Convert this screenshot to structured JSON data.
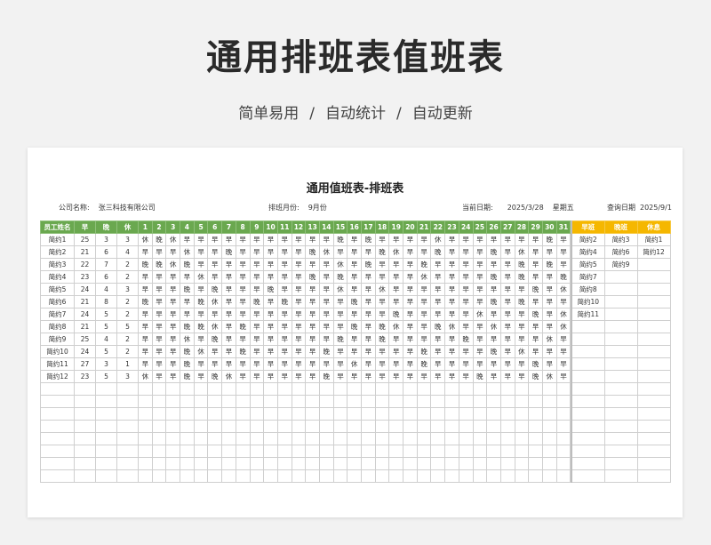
{
  "hero": {
    "title": "通用排班表值班表",
    "subtitle": [
      "简单易用",
      "自动统计",
      "自动更新"
    ],
    "separator": "/"
  },
  "sheet": {
    "title": "通用值班表-排班表",
    "company_label": "公司名称:",
    "company_value": "张三科技有限公司",
    "month_label": "排班月份:",
    "month_value": "9月份",
    "date_label": "当前日期:",
    "date_value": "2025/3/28",
    "weekday_value": "星期五",
    "query_label": "查询日期",
    "query_value": "2025/9/1"
  },
  "colors": {
    "header_green": "#6aa84f",
    "header_orange": "#f5b700"
  },
  "table": {
    "headers": [
      "员工姓名",
      "早",
      "晚",
      "休",
      "1",
      "2",
      "3",
      "4",
      "5",
      "6",
      "7",
      "8",
      "9",
      "10",
      "11",
      "12",
      "13",
      "14",
      "15",
      "16",
      "17",
      "18",
      "19",
      "20",
      "21",
      "22",
      "23",
      "24",
      "25",
      "26",
      "27",
      "28",
      "29",
      "30",
      "31"
    ],
    "rows": [
      {
        "name": "简约1",
        "early": "25",
        "late": "3",
        "off": "3",
        "days": [
          "休",
          "晚",
          "休",
          "早",
          "早",
          "早",
          "早",
          "早",
          "早",
          "早",
          "早",
          "早",
          "早",
          "早",
          "晚",
          "早",
          "晚",
          "早",
          "早",
          "早",
          "早",
          "休",
          "早",
          "早",
          "早",
          "早",
          "早",
          "早",
          "早",
          "晚",
          "早"
        ]
      },
      {
        "name": "简约2",
        "early": "21",
        "late": "6",
        "off": "4",
        "days": [
          "早",
          "早",
          "早",
          "休",
          "早",
          "早",
          "晚",
          "早",
          "早",
          "早",
          "早",
          "早",
          "晚",
          "休",
          "早",
          "早",
          "早",
          "晚",
          "休",
          "早",
          "早",
          "晚",
          "早",
          "早",
          "早",
          "晚",
          "早",
          "休",
          "早",
          "早",
          "早"
        ]
      },
      {
        "name": "简约3",
        "early": "22",
        "late": "7",
        "off": "2",
        "days": [
          "晚",
          "晚",
          "休",
          "晚",
          "早",
          "早",
          "早",
          "早",
          "早",
          "早",
          "早",
          "早",
          "早",
          "早",
          "休",
          "早",
          "晚",
          "早",
          "早",
          "早",
          "晚",
          "早",
          "早",
          "早",
          "早",
          "早",
          "早",
          "晚",
          "早",
          "晚",
          "早"
        ]
      },
      {
        "name": "简约4",
        "early": "23",
        "late": "6",
        "off": "2",
        "days": [
          "早",
          "早",
          "早",
          "早",
          "休",
          "早",
          "早",
          "早",
          "早",
          "早",
          "早",
          "早",
          "晚",
          "早",
          "晚",
          "早",
          "早",
          "早",
          "早",
          "早",
          "休",
          "早",
          "早",
          "早",
          "早",
          "晚",
          "早",
          "晚",
          "早",
          "早",
          "晚"
        ]
      },
      {
        "name": "简约5",
        "early": "24",
        "late": "4",
        "off": "3",
        "days": [
          "早",
          "早",
          "早",
          "晚",
          "早",
          "晚",
          "早",
          "早",
          "早",
          "晚",
          "早",
          "早",
          "早",
          "早",
          "休",
          "早",
          "早",
          "休",
          "早",
          "早",
          "早",
          "早",
          "早",
          "早",
          "早",
          "早",
          "早",
          "早",
          "晚",
          "早",
          "休"
        ]
      },
      {
        "name": "简约6",
        "early": "21",
        "late": "8",
        "off": "2",
        "days": [
          "晚",
          "早",
          "早",
          "早",
          "晚",
          "休",
          "早",
          "早",
          "晚",
          "早",
          "晚",
          "早",
          "早",
          "早",
          "早",
          "晚",
          "早",
          "早",
          "早",
          "早",
          "早",
          "早",
          "早",
          "早",
          "早",
          "晚",
          "早",
          "晚",
          "早",
          "早",
          "早"
        ]
      },
      {
        "name": "简约7",
        "early": "24",
        "late": "5",
        "off": "2",
        "days": [
          "早",
          "早",
          "早",
          "早",
          "早",
          "早",
          "早",
          "早",
          "早",
          "早",
          "早",
          "早",
          "早",
          "早",
          "早",
          "早",
          "早",
          "早",
          "晚",
          "早",
          "早",
          "早",
          "早",
          "早",
          "休",
          "早",
          "早",
          "早",
          "晚",
          "早",
          "休"
        ]
      },
      {
        "name": "简约8",
        "early": "21",
        "late": "5",
        "off": "5",
        "days": [
          "早",
          "早",
          "早",
          "晚",
          "晚",
          "休",
          "早",
          "晚",
          "早",
          "早",
          "早",
          "早",
          "早",
          "早",
          "早",
          "晚",
          "早",
          "晚",
          "休",
          "早",
          "早",
          "晚",
          "休",
          "早",
          "早",
          "休",
          "早",
          "早",
          "早",
          "早",
          "休"
        ]
      },
      {
        "name": "简约9",
        "early": "25",
        "late": "4",
        "off": "2",
        "days": [
          "早",
          "早",
          "早",
          "休",
          "早",
          "晚",
          "早",
          "早",
          "早",
          "早",
          "早",
          "早",
          "早",
          "早",
          "晚",
          "早",
          "早",
          "晚",
          "早",
          "早",
          "早",
          "早",
          "早",
          "晚",
          "早",
          "早",
          "早",
          "早",
          "早",
          "休",
          "早"
        ]
      },
      {
        "name": "简约10",
        "early": "24",
        "late": "5",
        "off": "2",
        "days": [
          "早",
          "早",
          "早",
          "晚",
          "休",
          "早",
          "早",
          "晚",
          "早",
          "早",
          "早",
          "早",
          "早",
          "晚",
          "早",
          "早",
          "早",
          "早",
          "早",
          "早",
          "晚",
          "早",
          "早",
          "早",
          "早",
          "晚",
          "早",
          "休",
          "早",
          "早",
          "早"
        ]
      },
      {
        "name": "简约11",
        "early": "27",
        "late": "3",
        "off": "1",
        "days": [
          "早",
          "早",
          "早",
          "晚",
          "早",
          "早",
          "早",
          "早",
          "早",
          "早",
          "早",
          "早",
          "早",
          "早",
          "早",
          "休",
          "早",
          "早",
          "早",
          "早",
          "晚",
          "早",
          "早",
          "早",
          "早",
          "早",
          "早",
          "早",
          "晚",
          "早",
          "早"
        ]
      },
      {
        "name": "简约12",
        "early": "23",
        "late": "5",
        "off": "3",
        "days": [
          "休",
          "早",
          "早",
          "晚",
          "早",
          "晚",
          "休",
          "早",
          "早",
          "早",
          "早",
          "早",
          "早",
          "晚",
          "早",
          "早",
          "早",
          "早",
          "早",
          "早",
          "早",
          "早",
          "早",
          "早",
          "晚",
          "早",
          "早",
          "早",
          "晚",
          "休",
          "早"
        ]
      }
    ],
    "empty_rows": 8
  },
  "side": {
    "headers": [
      "早班",
      "晚班",
      "休息"
    ],
    "rows": [
      [
        "简约2",
        "简约3",
        "简约1"
      ],
      [
        "简约4",
        "简约6",
        "简约12"
      ],
      [
        "简约5",
        "简约9",
        ""
      ],
      [
        "简约7",
        "",
        ""
      ],
      [
        "简约8",
        "",
        ""
      ],
      [
        "简约10",
        "",
        ""
      ],
      [
        "简约11",
        "",
        ""
      ]
    ],
    "total_rows": 20
  }
}
